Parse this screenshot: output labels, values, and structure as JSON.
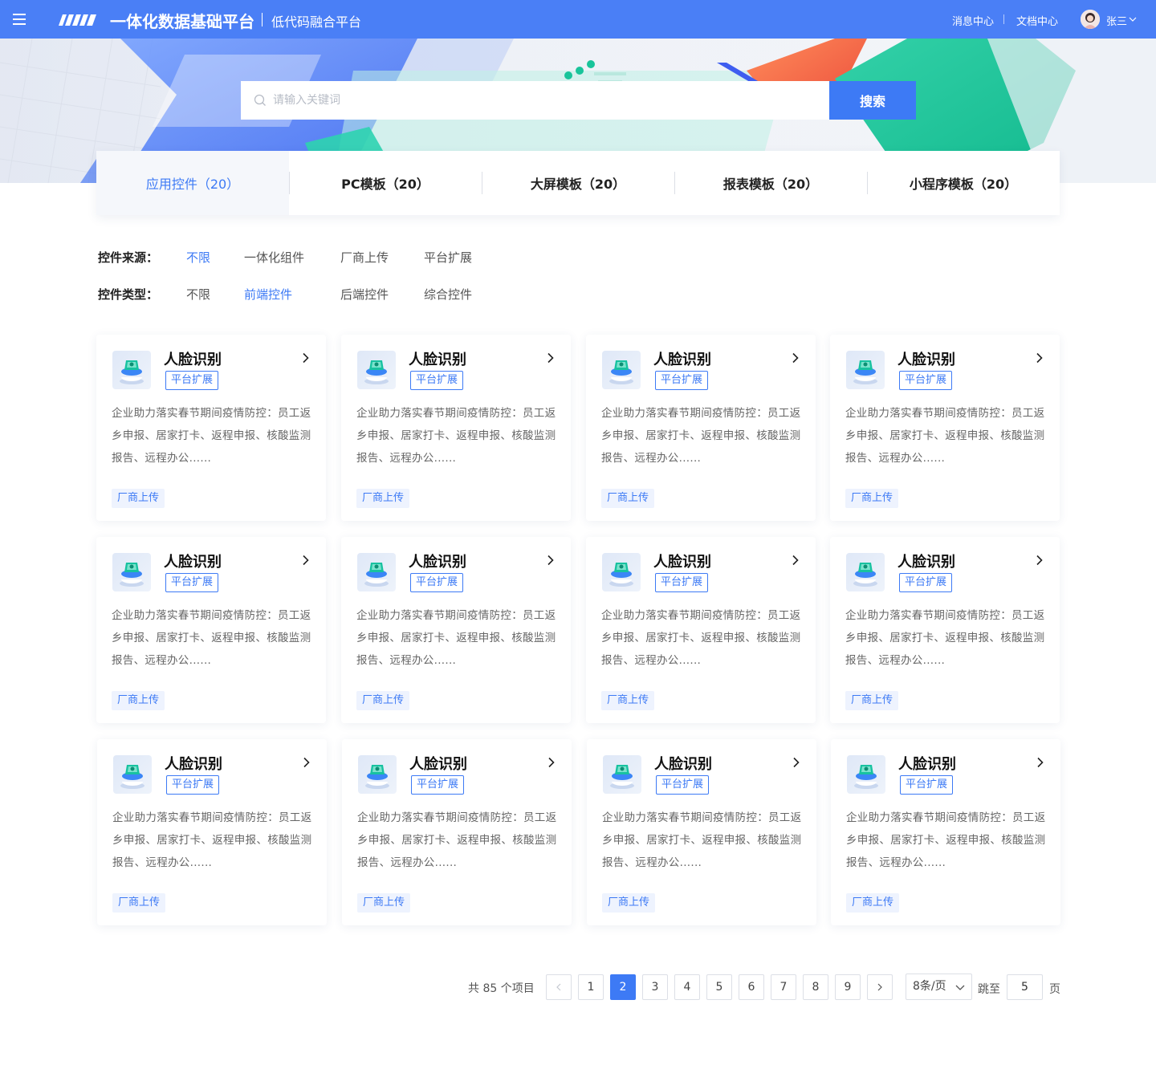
{
  "header": {
    "brand": "一体化数据基础平台",
    "subbrand": "低代码融合平台",
    "links": [
      "消息中心",
      "文档中心"
    ],
    "username": "张三",
    "accent": "#4a7ff6"
  },
  "search": {
    "placeholder": "请输入关键词",
    "value": "",
    "button": "搜索"
  },
  "tabs": [
    {
      "label": "应用控件（20）",
      "active": true
    },
    {
      "label": "PC模板（20）",
      "active": false
    },
    {
      "label": "大屏模板（20）",
      "active": false
    },
    {
      "label": "报表模板（20）",
      "active": false
    },
    {
      "label": "小程序模板（20）",
      "active": false
    }
  ],
  "filters": [
    {
      "label": "控件来源：",
      "options": [
        "不限",
        "一体化组件",
        "厂商上传",
        "平台扩展"
      ],
      "active": 0
    },
    {
      "label": "控件类型：",
      "options": [
        "不限",
        "前端控件",
        "后端控件",
        "综合控件"
      ],
      "active": 1
    }
  ],
  "cards": [
    {
      "title": "人脸识别",
      "badge": "平台扩展",
      "desc": "企业助力落实春节期间疫情防控：员工返乡申报、居家打卡、返程申报、核酸监测报告、远程办公......",
      "tag": "厂商上传",
      "icon": "face-recognition-icon"
    },
    {
      "title": "人脸识别",
      "badge": "平台扩展",
      "desc": "企业助力落实春节期间疫情防控：员工返乡申报、居家打卡、返程申报、核酸监测报告、远程办公......",
      "tag": "厂商上传",
      "icon": "face-recognition-icon"
    },
    {
      "title": "人脸识别",
      "badge": "平台扩展",
      "desc": "企业助力落实春节期间疫情防控：员工返乡申报、居家打卡、返程申报、核酸监测报告、远程办公......",
      "tag": "厂商上传",
      "icon": "face-recognition-icon"
    },
    {
      "title": "人脸识别",
      "badge": "平台扩展",
      "desc": "企业助力落实春节期间疫情防控：员工返乡申报、居家打卡、返程申报、核酸监测报告、远程办公......",
      "tag": "厂商上传",
      "icon": "face-recognition-icon"
    },
    {
      "title": "人脸识别",
      "badge": "平台扩展",
      "desc": "企业助力落实春节期间疫情防控：员工返乡申报、居家打卡、返程申报、核酸监测报告、远程办公......",
      "tag": "厂商上传",
      "icon": "face-recognition-icon"
    },
    {
      "title": "人脸识别",
      "badge": "平台扩展",
      "desc": "企业助力落实春节期间疫情防控：员工返乡申报、居家打卡、返程申报、核酸监测报告、远程办公......",
      "tag": "厂商上传",
      "icon": "face-recognition-icon"
    },
    {
      "title": "人脸识别",
      "badge": "平台扩展",
      "desc": "企业助力落实春节期间疫情防控：员工返乡申报、居家打卡、返程申报、核酸监测报告、远程办公......",
      "tag": "厂商上传",
      "icon": "face-recognition-icon"
    },
    {
      "title": "人脸识别",
      "badge": "平台扩展",
      "desc": "企业助力落实春节期间疫情防控：员工返乡申报、居家打卡、返程申报、核酸监测报告、远程办公......",
      "tag": "厂商上传",
      "icon": "face-recognition-icon"
    },
    {
      "title": "人脸识别",
      "badge": "平台扩展",
      "desc": "企业助力落实春节期间疫情防控：员工返乡申报、居家打卡、返程申报、核酸监测报告、远程办公......",
      "tag": "厂商上传",
      "icon": "face-recognition-icon"
    },
    {
      "title": "人脸识别",
      "badge": "平台扩展",
      "desc": "企业助力落实春节期间疫情防控：员工返乡申报、居家打卡、返程申报、核酸监测报告、远程办公......",
      "tag": "厂商上传",
      "icon": "face-recognition-icon"
    },
    {
      "title": "人脸识别",
      "badge": "平台扩展",
      "desc": "企业助力落实春节期间疫情防控：员工返乡申报、居家打卡、返程申报、核酸监测报告、远程办公......",
      "tag": "厂商上传",
      "icon": "face-recognition-icon"
    },
    {
      "title": "人脸识别",
      "badge": "平台扩展",
      "desc": "企业助力落实春节期间疫情防控：员工返乡申报、居家打卡、返程申报、核酸监测报告、远程办公......",
      "tag": "厂商上传",
      "icon": "face-recognition-icon"
    }
  ],
  "pagination": {
    "total_text": "共 85 个项目",
    "pages": [
      "1",
      "2",
      "3",
      "4",
      "5",
      "6",
      "7",
      "8",
      "9"
    ],
    "current": 2,
    "page_size": "8条/页",
    "jump_label": "跳至",
    "jump_value": "5",
    "unit": "页"
  }
}
